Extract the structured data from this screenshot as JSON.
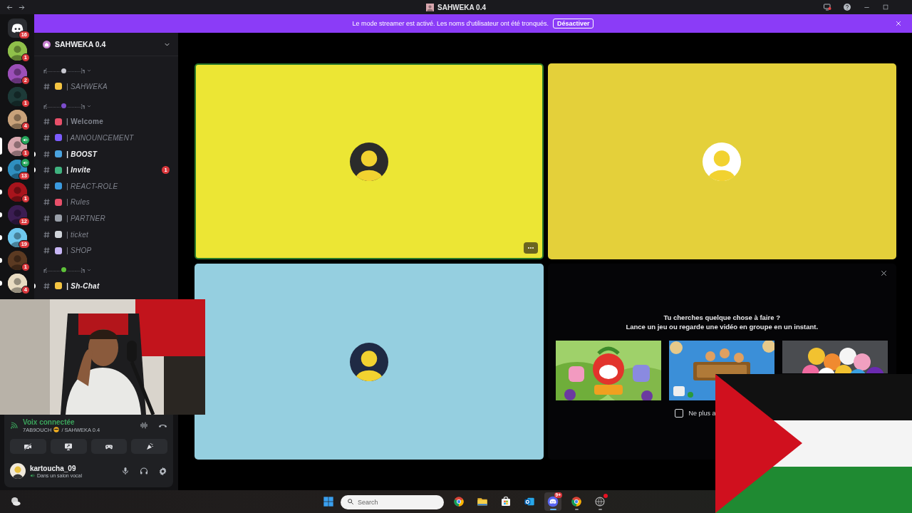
{
  "title_bar": {
    "title": "SAHWEKA 0.4"
  },
  "banner": {
    "message": "Le mode streamer est activé. Les noms d'utilisateur ont été tronqués.",
    "button": "Désactiver"
  },
  "servers": [
    {
      "kind": "home",
      "badge": "16",
      "selected": false,
      "unread": false,
      "voice": false,
      "color": "#2b2d31"
    },
    {
      "kind": "avatar",
      "badge": "1",
      "selected": false,
      "unread": false,
      "voice": false,
      "color": "#8fc04a"
    },
    {
      "kind": "avatar",
      "badge": "2",
      "selected": false,
      "unread": false,
      "voice": false,
      "color": "#9b4fb8"
    },
    {
      "kind": "avatar",
      "badge": "1",
      "selected": false,
      "unread": false,
      "voice": false,
      "color": "#1d3a38"
    },
    {
      "kind": "avatar",
      "badge": "4",
      "selected": false,
      "unread": false,
      "voice": false,
      "color": "#c9a27a"
    },
    {
      "kind": "avatar",
      "badge": "1",
      "selected": true,
      "unread": false,
      "voice": true,
      "color": "#d8a7ae"
    },
    {
      "kind": "avatar",
      "badge": "13",
      "selected": false,
      "unread": true,
      "voice": true,
      "color": "#2f8fc0"
    },
    {
      "kind": "avatar",
      "badge": "1",
      "selected": false,
      "unread": true,
      "voice": false,
      "color": "#a8141c"
    },
    {
      "kind": "avatar",
      "badge": "12",
      "selected": false,
      "unread": true,
      "voice": false,
      "color": "#3b1d52"
    },
    {
      "kind": "avatar",
      "badge": "19",
      "selected": false,
      "unread": true,
      "voice": false,
      "color": "#6fc8ee"
    },
    {
      "kind": "avatar",
      "badge": "1",
      "selected": false,
      "unread": true,
      "voice": false,
      "color": "#5b3a22"
    },
    {
      "kind": "avatar",
      "badge": "4",
      "selected": false,
      "unread": true,
      "voice": false,
      "color": "#e9dcc2"
    }
  ],
  "server_header": {
    "name": "SAHWEKA 0.4"
  },
  "channels": [
    {
      "kind": "category",
      "left": "┏[..........",
      "right": "..........]┓"
    },
    {
      "kind": "channel",
      "name": "| SAHWEKA",
      "unread": false,
      "italic": true
    },
    {
      "kind": "category",
      "left": "┏[..........",
      "right": "..........]┓"
    },
    {
      "kind": "channel",
      "name": "| Welcome",
      "unread": false,
      "italic": false
    },
    {
      "kind": "channel",
      "name": "| ANNOUNCEMENT",
      "unread": false,
      "italic": true
    },
    {
      "kind": "channel",
      "name": "| BOOST",
      "unread": true,
      "italic": true
    },
    {
      "kind": "channel",
      "name": "| Invite",
      "unread": true,
      "italic": true,
      "mentions": "1"
    },
    {
      "kind": "channel",
      "name": "| REACT-ROLE",
      "unread": false,
      "italic": true
    },
    {
      "kind": "channel",
      "name": "| Rules",
      "unread": false,
      "italic": true
    },
    {
      "kind": "channel",
      "name": "| PARTNER",
      "unread": false,
      "italic": true
    },
    {
      "kind": "channel",
      "name": "| ticket",
      "unread": false,
      "italic": true
    },
    {
      "kind": "channel",
      "name": "| SHOP",
      "unread": false,
      "italic": true
    },
    {
      "kind": "category",
      "left": "┏[..........",
      "right": "..........]┓"
    },
    {
      "kind": "channel",
      "name": "| Sh-Chat",
      "unread": true,
      "italic": true
    }
  ],
  "voice": {
    "status": "Voix connectée",
    "channel_user": "7AB9OUCH",
    "channel_path": "/ SAHWEKA 0.4"
  },
  "user": {
    "name": "kartoucha_09",
    "status": "Dans un salon vocal"
  },
  "tiles": [
    {
      "kind": "user",
      "color": "#ece634",
      "speaking": true
    },
    {
      "kind": "user",
      "color": "#e4d03a",
      "speaking": false
    },
    {
      "kind": "user",
      "color": "#95cfe0",
      "speaking": false
    },
    {
      "kind": "activities"
    }
  ],
  "activities": {
    "heading": "Tu cherches quelque chose à faire ?",
    "subheading": "Lance un jeu ou regarde une vidéo en groupe en un instant.",
    "checkbox": {
      "label": "Ne plus a",
      "checked": false
    }
  },
  "taskbar": {
    "search_placeholder": "Search",
    "apps": [
      {
        "kind": "chrome",
        "active": false,
        "running": false
      },
      {
        "kind": "folder",
        "active": false,
        "running": false
      },
      {
        "kind": "store",
        "active": false,
        "running": false
      },
      {
        "kind": "outlook",
        "active": false,
        "running": false
      },
      {
        "kind": "discord",
        "active": true,
        "running": true,
        "badge": "9+"
      },
      {
        "kind": "chrome",
        "active": false,
        "running": true
      },
      {
        "kind": "globe",
        "active": false,
        "running": true,
        "notification": true
      }
    ]
  }
}
